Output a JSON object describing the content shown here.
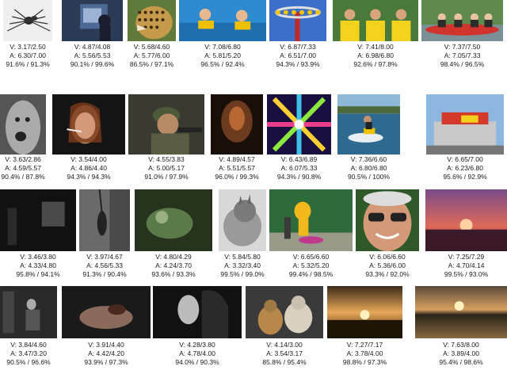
{
  "tiles": [
    {
      "name": "spider",
      "v": "V: 3.17/2.50",
      "a": "A: 6.30/7.00",
      "p": "91.6% / 91.3%"
    },
    {
      "name": "tv-room",
      "v": "V: 4.87/4.08",
      "a": "A: 5.56/5.53",
      "p": "90.1% / 99.6%"
    },
    {
      "name": "leopard",
      "v": "V: 5.68/4.60",
      "a": "A: 5.77/6.00",
      "p": "86.5% / 97.1%"
    },
    {
      "name": "swimming-kids",
      "v": "V: 7.08/6.80",
      "a": "A: 5.81/5.20",
      "p": "96.5% / 92.4%"
    },
    {
      "name": "carnival-ride",
      "v": "V: 6.87/7.33",
      "a": "A: 6.51/7.00",
      "p": "94.3% / 93.9%"
    },
    {
      "name": "cheering-kids",
      "v": "V: 7.41/8.00",
      "a": "A: 6.98/6.80",
      "p": "92.6% / 97.8%"
    },
    {
      "name": "rafting",
      "v": "V: 7.37/7.50",
      "a": "A: 7.05/7.33",
      "p": "98.4% / 96.5%"
    },
    {
      "name": "screaming-man",
      "v": "V: 3.63/2.86",
      "a": "A: 4.59/5.57",
      "p": "90.4% / 87.8%"
    },
    {
      "name": "smoking-woman",
      "v": "V: 3.54/4.00",
      "a": "A: 4.86/4.40",
      "p": "94.3% / 94.3%"
    },
    {
      "name": "soldier",
      "v": "V: 4.55/3.83",
      "a": "A: 5.00/5.17",
      "p": "91.0% / 97.9%"
    },
    {
      "name": "dark-figure",
      "v": "V: 4.89/4.57",
      "a": "A: 5.51/5.57",
      "p": "96.0% / 99.3%"
    },
    {
      "name": "kaleidoscope",
      "v": "V: 6.43/6.89",
      "a": "A: 6.07/5.33",
      "p": "94.3% / 90.8%"
    },
    {
      "name": "jetski",
      "v": "V: 7.36/6.60",
      "a": "A: 6.80/6.80",
      "p": "90.5% / 100%"
    },
    {
      "name": "fair-stand",
      "v": "V: 6.65/7.00",
      "a": "A: 6.23/6.80",
      "p": "95.6% / 92.9%"
    },
    {
      "name": "dark-room",
      "v": "V: 3.46/3.80",
      "a": "A: 4.33/4.80",
      "p": "95.8% / 94.1%"
    },
    {
      "name": "hanging-figure",
      "v": "V: 3.97/4.67",
      "a": "A: 4.56/5.33",
      "p": "91.3% / 90.4%"
    },
    {
      "name": "green-scene",
      "v": "V: 4.80/4.29",
      "a": "A: 4.24/3.70",
      "p": "93.6% / 93.3%"
    },
    {
      "name": "cat",
      "v": "V: 5.84/5.80",
      "a": "A: 3.32/3.40",
      "p": "99.5% / 99.0%"
    },
    {
      "name": "parade",
      "v": "V: 6.65/6.60",
      "a": "A: 5.32/5.20",
      "p": "99.4% / 98.5%"
    },
    {
      "name": "old-man",
      "v": "V: 6.06/6.60",
      "a": "A: 5.36/6.00",
      "p": "93.3% / 92.0%"
    },
    {
      "name": "sunset-sea",
      "v": "V: 7.25/7.29",
      "a": "A: 4.70/4.14",
      "p": "99.5% / 93.0%"
    },
    {
      "name": "seated-man",
      "v": "V: 3.84/4.60",
      "a": "A: 3.47/3.20",
      "p": "90.5% / 96.6%"
    },
    {
      "name": "hands",
      "v": "V: 3.91/4.40",
      "a": "A: 4.42/4.20",
      "p": "93.9% / 97.3%"
    },
    {
      "name": "two-women",
      "v": "V: 4.28/3.80",
      "a": "A: 4.78/4.00",
      "p": "94.0% / 90.3%"
    },
    {
      "name": "two-cats",
      "v": "V: 4.14/3.00",
      "a": "A: 3.54/3.17",
      "p": "85.8% / 95.4%"
    },
    {
      "name": "sunset-field",
      "v": "V: 7.27/7.17",
      "a": "A: 3.78/4.00",
      "p": "98.8% / 97.3%"
    },
    {
      "name": "sunset-lake",
      "v": "V: 7.63/8.00",
      "a": "A: 3.89/4.00",
      "p": "95.4% / 98.6%"
    }
  ]
}
